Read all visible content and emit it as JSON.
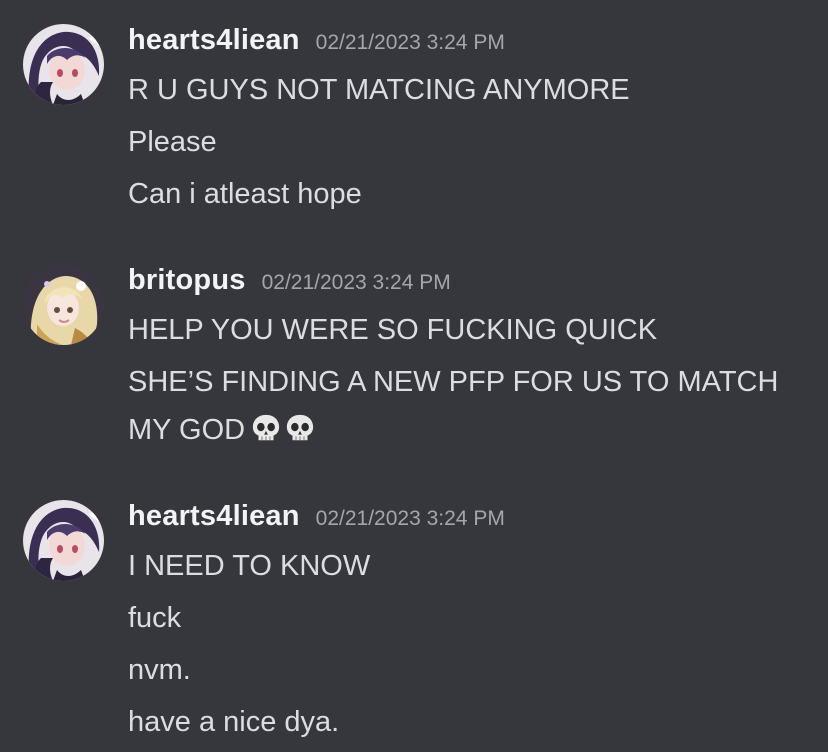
{
  "colors": {
    "background": "#35373c",
    "username": "#f2f3f5",
    "timestamp": "#a3a6ad",
    "message_text": "#dbdee1"
  },
  "messages": [
    {
      "author": "hearts4liean",
      "timestamp": "02/21/2023 3:24 PM",
      "avatar_icon": "avatar-purple-hair",
      "lines": [
        "R U GUYS NOT MATCING ANYMORE",
        "Please",
        "Can i atleast hope"
      ]
    },
    {
      "author": "britopus",
      "timestamp": "02/21/2023 3:24 PM",
      "avatar_icon": "avatar-blonde-hair",
      "lines": [
        "HELP YOU WERE SO FUCKING QUICK",
        "SHE’S FINDING A NEW PFP FOR US TO MATCH",
        "MY GOD"
      ],
      "emojis": [
        "skull-emoji",
        "skull-emoji"
      ]
    },
    {
      "author": "hearts4liean",
      "timestamp": "02/21/2023 3:24 PM",
      "avatar_icon": "avatar-purple-hair",
      "lines": [
        "I NEED TO KNOW",
        "fuck",
        "nvm.",
        "have a nice dya."
      ]
    }
  ]
}
